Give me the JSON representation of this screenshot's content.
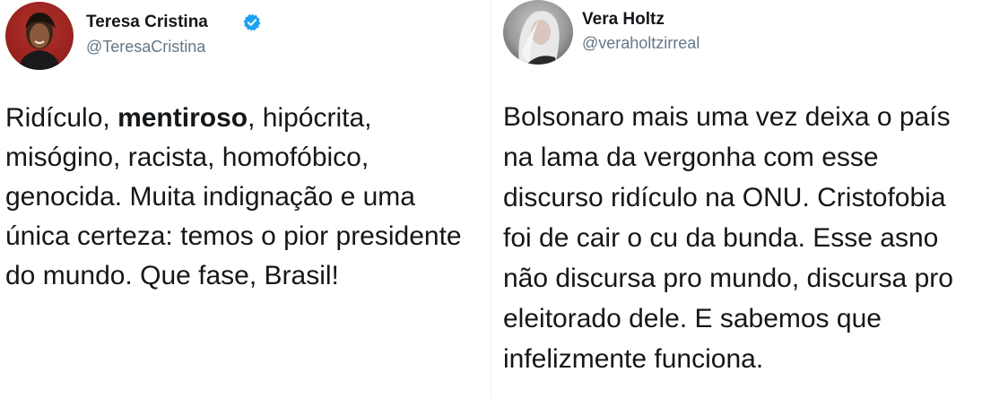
{
  "tweets": [
    {
      "display_name": "Teresa Cristina",
      "handle": "@TeresaCristina",
      "verified": true,
      "verified_color": "#1da1f2",
      "avatar_icon": "profile-photo",
      "body_lines": [
        {
          "pre": "Ridículo, ",
          "bold": "mentiroso",
          "post": ", hipócrita,"
        },
        {
          "pre": "misógino, racista, homofóbico,",
          "bold": "",
          "post": ""
        },
        {
          "pre": "genocida. Muita indignação e uma",
          "bold": "",
          "post": ""
        },
        {
          "pre": "única certeza: temos o pior presidente",
          "bold": "",
          "post": ""
        },
        {
          "pre": "do mundo. Que fase, Brasil!",
          "bold": "",
          "post": ""
        }
      ]
    },
    {
      "display_name": "Vera Holtz",
      "handle": "@veraholtzirreal",
      "verified": false,
      "avatar_icon": "profile-photo",
      "body_lines": [
        "Bolsonaro mais uma vez deixa o país",
        "na lama da vergonha com esse",
        "discurso ridículo na ONU. Cristofobia",
        "foi de cair o cu da bunda. Esse asno",
        "não discursa pro mundo, discursa pro",
        "eleitorado dele. E sabemos que",
        "infelizmente funciona."
      ]
    }
  ],
  "colors": {
    "text": "#14171a",
    "secondary": "#657786",
    "background": "#ffffff"
  }
}
